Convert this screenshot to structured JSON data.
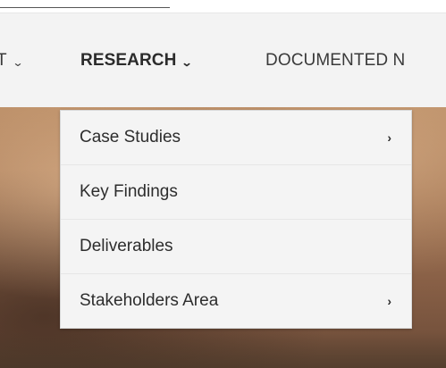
{
  "nav": {
    "items": [
      {
        "label": "T",
        "has_dropdown": true
      },
      {
        "label": "RESEARCH",
        "has_dropdown": true,
        "active": true
      },
      {
        "label": "DOCUMENTED N",
        "has_dropdown": false
      }
    ],
    "chevron": "⌄"
  },
  "dropdown": {
    "items": [
      {
        "label": "Case Studies",
        "has_submenu": true
      },
      {
        "label": "Key Findings",
        "has_submenu": false
      },
      {
        "label": "Deliverables",
        "has_submenu": false
      },
      {
        "label": "Stakeholders Area",
        "has_submenu": true
      }
    ],
    "submenu_arrow": "›"
  },
  "colors": {
    "navbar_bg": "#f3f3f3",
    "dropdown_bg": "#f4f4f4",
    "text": "#2d2d2d"
  },
  "icons": [
    "chevron-down-icon",
    "chevron-right-icon"
  ]
}
